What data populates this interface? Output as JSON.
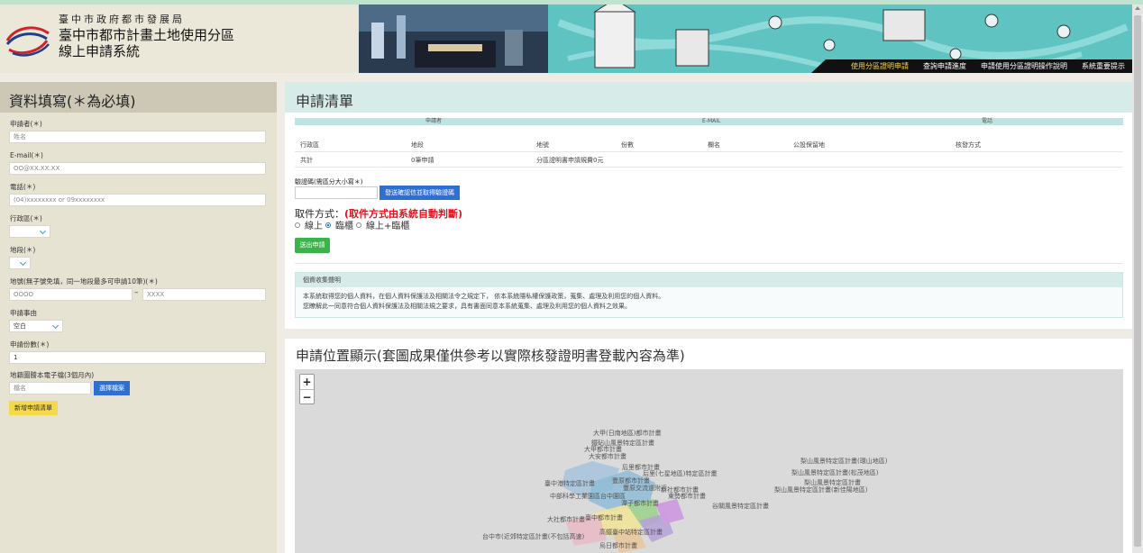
{
  "header": {
    "org": "臺中市政府都市發展局",
    "system_line1": "臺中市都市計畫土地使用分區",
    "system_line2": "線上申請系統",
    "nav": [
      {
        "label": "使用分區證明申請",
        "active": true
      },
      {
        "label": "查詢申請進度",
        "active": false
      },
      {
        "label": "申請使用分區證明操作說明",
        "active": false
      },
      {
        "label": "系統重要提示",
        "active": false
      }
    ]
  },
  "form": {
    "title": "資料填寫(＊為必填)",
    "applicant_label": "申請者(＊)",
    "applicant_placeholder": "姓名",
    "email_label": "E-mail(＊)",
    "email_placeholder": "OO@XX.XX.XX",
    "phone_label": "電話(＊)",
    "phone_placeholder": "(04)xxxxxxxx or 09xxxxxxxx",
    "district_label": "行政區(＊)",
    "district_value": "",
    "section_label": "地段(＊)",
    "section_value": "",
    "lot_label": "地號(無子號免填，同一地段最多可申請10筆)(＊)",
    "lot_main_placeholder": "OOOO",
    "lot_sub_placeholder": "XXXX",
    "lot_separator": "–",
    "reason_label": "申請事由",
    "reason_value": "空白",
    "copies_label": "申請份數(＊)",
    "copies_value": "1",
    "cadastral_label": "地籍圖謄本電子檔(3個月內)",
    "file_placeholder": "檔名",
    "choose_file_button": "選擇檔案",
    "add_button": "新增申請清單"
  },
  "list": {
    "title": "申請清單",
    "header_cols": [
      "申請者",
      "E-MAIL",
      "電話"
    ],
    "columns": [
      "行政區",
      "地段",
      "地號",
      "份數",
      "欄名",
      "公設保留地",
      "核發方式"
    ],
    "summary": [
      "共計",
      "0筆申請",
      "分區證明書申請規費0元"
    ],
    "captcha_label": "驗證碼(需區分大小寫＊)",
    "captcha_button": "發送確認信並取得驗證碼",
    "method_title": "取件方式：",
    "method_note": "(取件方式由系統自動判斷)",
    "methods": [
      {
        "label": "線上",
        "selected": false
      },
      {
        "label": "臨櫃",
        "selected": true
      },
      {
        "label": "線上+臨櫃",
        "selected": false
      }
    ],
    "submit_button": "送出申請",
    "privacy_title": "個資收集聲明",
    "privacy_line1": "本系統取得您的個人資料，在個人資料保護法及相關法令之規定下， 依本系統隱私權保護政策，蒐集、處理及利用您的個人資料。",
    "privacy_line2": "您瞭解此一同意符合個人資料保護法及相關法規之要求，具有書面同意本系統蒐集、處理及利用您的個人資料之效果。"
  },
  "map": {
    "title": "申請位置顯示(套圖成果僅供參考以實際核發證明書登載內容為準)",
    "zoom_in": "+",
    "zoom_out": "−",
    "labels": [
      "大甲(日南地區)都市計畫",
      "鐵砧山風景特定區計畫",
      "大甲都市計畫",
      "大安都市計畫",
      "后里都市計畫",
      "后里(七星地區)特定區計畫",
      "豐原都市計畫",
      "臺中港特定區計畫",
      "豐原交流道附近",
      "中部科學工業園區台中園區",
      "潭子都市計畫",
      "東勢都市計畫",
      "新社都市計畫",
      "大社都市計畫",
      "臺中都市計畫",
      "高鐵臺中站特定區計畫",
      "台中市(近郊特定區計畫(不包括高速)",
      "梨山風景特定區計畫(環山地區)",
      "梨山風景特定區計畫(松茂地區)",
      "梨山風景特定區計畫",
      "梨山風景特定區計畫(新佳陽地區)",
      "谷關風景特定區計畫",
      "烏日都市計畫"
    ]
  }
}
